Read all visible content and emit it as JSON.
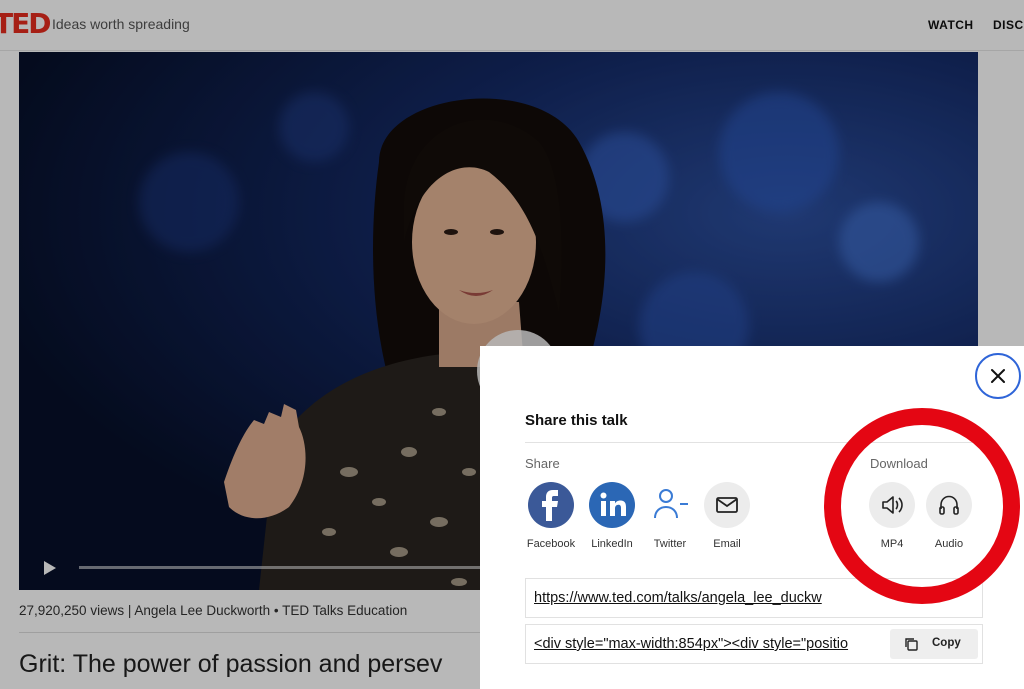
{
  "header": {
    "logo_text": "TED",
    "tagline": "Ideas worth spreading",
    "nav": {
      "watch": "WATCH",
      "discover": "DISCO"
    }
  },
  "video": {
    "meta": "27,920,250 views | Angela Lee Duckworth • TED Talks Education",
    "title": "Grit: The power of passion and persev"
  },
  "share_modal": {
    "title": "Share this talk",
    "share_label": "Share",
    "download_label": "Download",
    "share_options": [
      {
        "label": "Facebook",
        "icon": "facebook-icon"
      },
      {
        "label": "LinkedIn",
        "icon": "linkedin-icon"
      },
      {
        "label": "Twitter",
        "icon": "twitter-icon"
      },
      {
        "label": "Email",
        "icon": "email-icon"
      }
    ],
    "download_options": [
      {
        "label": "MP4",
        "icon": "speaker-icon"
      },
      {
        "label": "Audio",
        "icon": "headphones-icon"
      }
    ],
    "url": "https://www.ted.com/talks/angela_lee_duckw",
    "embed_code": "<div style=\"max-width:854px\"><div style=\"positio",
    "copy_label": "Copy"
  },
  "colors": {
    "ted_red": "#e62b1e",
    "facebook_blue": "#3b5998",
    "linkedin_blue": "#2b67b5",
    "close_ring": "#2f65d8",
    "highlight_ring": "#e40613"
  }
}
